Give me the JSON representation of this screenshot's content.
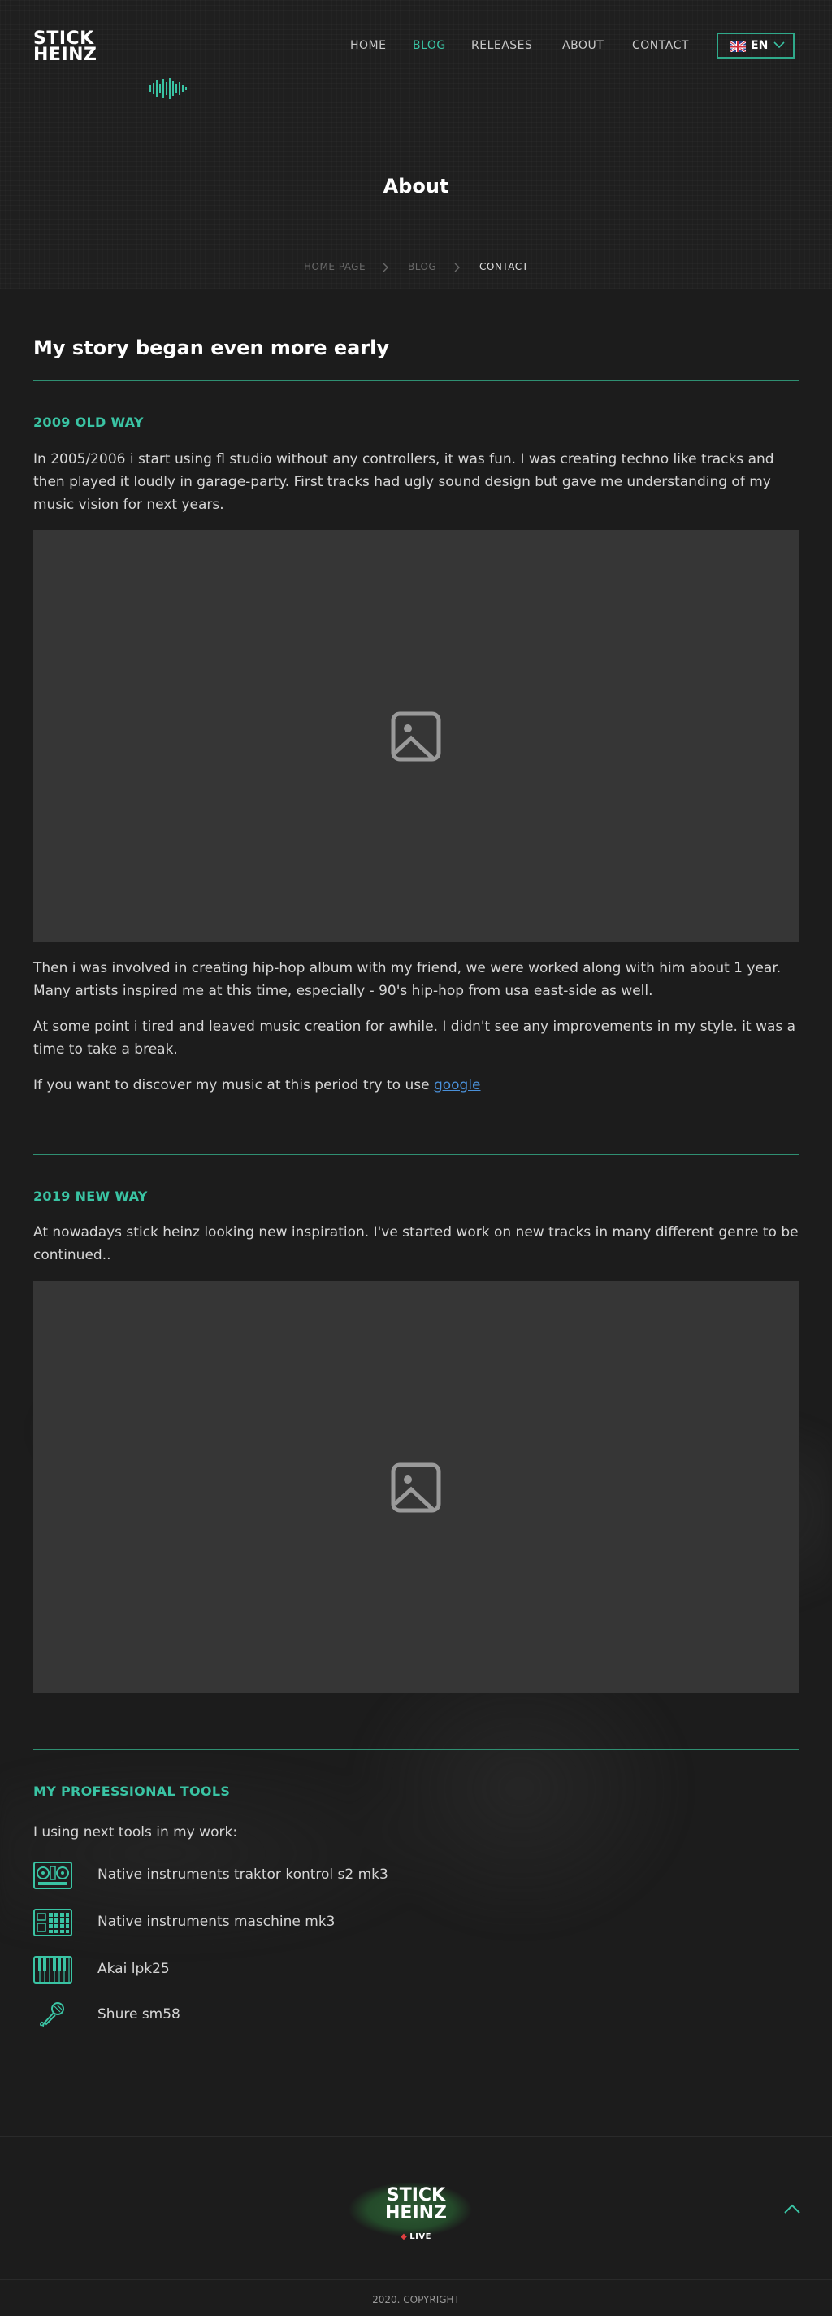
{
  "header": {
    "logo_line1": "STICK",
    "logo_line2": "HEINZ",
    "nav": [
      "HOME",
      "BLOG",
      "RELEASES",
      "ABOUT",
      "CONTACT"
    ],
    "active_nav": "BLOG",
    "language": "EN",
    "accent_color": "#3ac4a4"
  },
  "hero": {
    "title": "About",
    "breadcrumbs": [
      "HOME PAGE",
      "BLOG",
      "CONTACT"
    ]
  },
  "main": {
    "heading": "My story began even more early",
    "sections": [
      {
        "title": "2009 OLD WAY",
        "intro": "In 2005/2006 i start using fl studio without any controllers, it was fun. I was creating techno like tracks and then played it loudly in garage-party. First tracks had ugly sound design but gave me understanding of my music vision for next years.",
        "after": [
          "Then i was involved in creating hip-hop album with my friend, we were worked along with him about 1 year. Many artists inspired me at this time, especially - 90's hip-hop from usa east-side as well.",
          "At some point i tired and leaved music creation for awhile. I didn't see any improvements in my style. it was a time to take a break."
        ],
        "link_sentence": "If you want to discover my music at this period try to use ",
        "link_text": "google"
      },
      {
        "title": "2019 NEW WAY",
        "intro": "At nowadays stick heinz looking new inspiration. I've started work on new tracks in many different genre to be continued.."
      }
    ],
    "tools": {
      "title": "MY PROFESSIONAL TOOLS",
      "intro": "I using next tools in my work:",
      "items": [
        {
          "label": "Native instruments traktor kontrol s2 mk3",
          "icon": "dj-controller-icon"
        },
        {
          "label": "Native instruments maschine mk3",
          "icon": "drum-pad-icon"
        },
        {
          "label": "Akai lpk25",
          "icon": "keyboard-icon"
        },
        {
          "label": "Shure sm58",
          "icon": "microphone-icon"
        }
      ]
    }
  },
  "footer": {
    "logo_line1": "STICK",
    "logo_line2": "HEINZ",
    "live": "LIVE",
    "copyright": "2020. COPYRIGHT"
  }
}
